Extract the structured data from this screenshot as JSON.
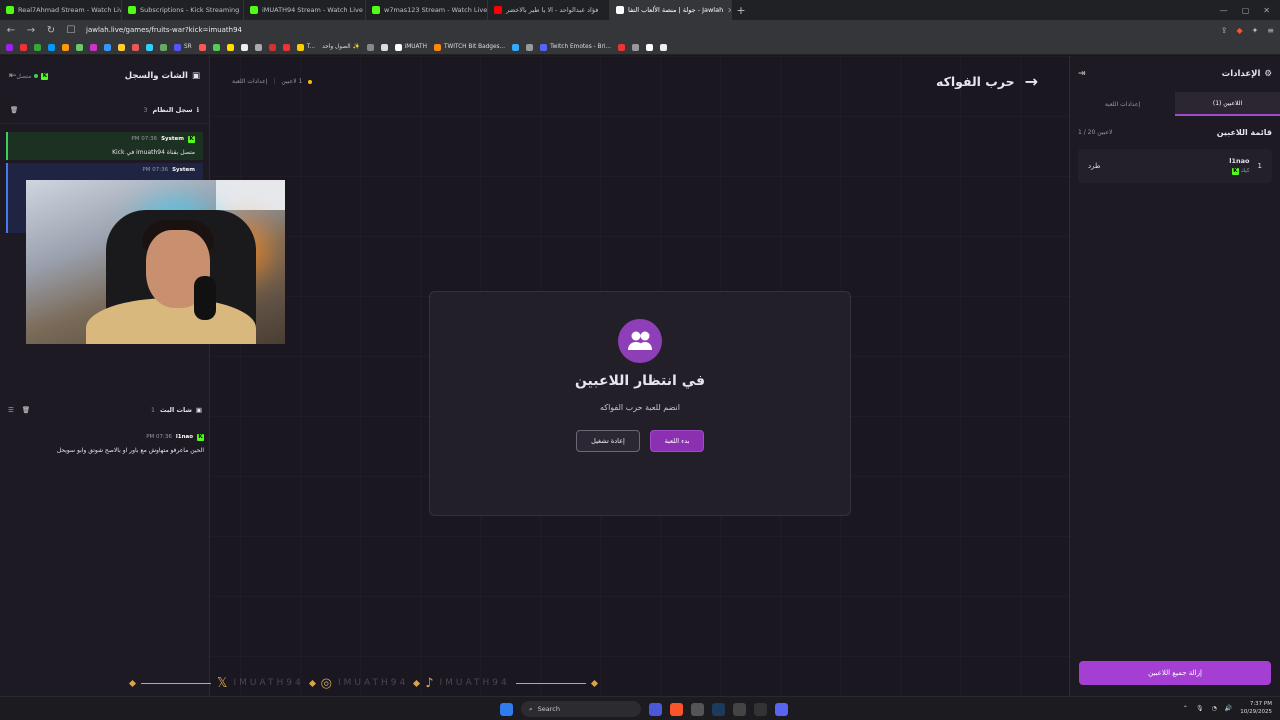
{
  "browser": {
    "tabs": [
      {
        "title": "Real7Ahmad Stream - Watch Live",
        "color": "#53fc18"
      },
      {
        "title": "Subscriptions - Kick Streaming",
        "color": "#53fc18"
      },
      {
        "title": "iMUATH94 Stream - Watch Live",
        "color": "#53fc18"
      },
      {
        "title": "w7mas123 Stream - Watch Live on",
        "color": "#53fc18"
      },
      {
        "title": "فؤاد عبدالواحد - الا يا طير بالاخضر",
        "color": "#ff0000"
      },
      {
        "title": "جولة | منصة الألعاب التفا - Jawlah",
        "color": "#ffffff"
      }
    ],
    "url": "jawlah.live/games/fruits-war?kick=imuath94",
    "bookmarks": [
      "SR",
      "T...",
      "الصول واحد ✨",
      "iMUATH",
      "TWITCH Bit Badges...",
      "Twitch Emotes - Bri..."
    ]
  },
  "left_panel": {
    "title": "الشات والسجل",
    "status": "متصل",
    "system_log": {
      "title": "سجل النظام",
      "count": "3",
      "messages": [
        {
          "sender": "System",
          "time": "PM 07:36",
          "text": "متصل بقناة imuath94 في Kick"
        },
        {
          "sender": "System",
          "time": "PM 07:36",
          "text": ""
        }
      ]
    },
    "live_chat": {
      "title": "شات البث",
      "count": "1",
      "messages": [
        {
          "sender": "l1nao",
          "time": "PM 07:36",
          "text": "الحين ماعرفو متهاوش مع باور او بالاصح شوتق وابو سويحل"
        }
      ]
    }
  },
  "main": {
    "players_info": "1 لاعبين",
    "game_settings_link": "إعدادات اللعبة",
    "game_title": "حرب الفواكه",
    "card": {
      "heading": "في انتظار اللاعبين",
      "subtitle": "انضم للعبة حرب الفواكه",
      "start_label": "بدء اللعبة",
      "restart_label": "إعادة تشغيل"
    },
    "social_handle": "IMUATH94"
  },
  "right_panel": {
    "title": "الإعدادات",
    "tab_players": "اللاعبين (1)",
    "tab_settings": "إعدادات اللعبة",
    "list_title": "قائمة اللاعبين",
    "list_count": "1 / 20 لاعبين",
    "players": [
      {
        "index": "1",
        "name": "l1nao",
        "platform": "كيك",
        "kick_label": "طرد"
      }
    ],
    "remove_all": "إزالة جميع اللاعبين"
  },
  "taskbar": {
    "search": "Search",
    "time": "7:37 PM",
    "date": "10/29/2025"
  }
}
